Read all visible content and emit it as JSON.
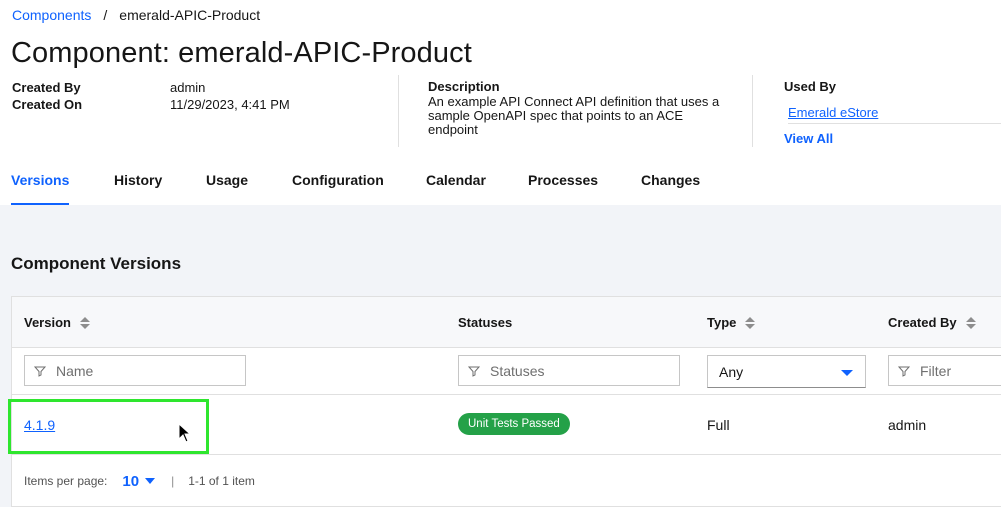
{
  "breadcrumb": {
    "root": "Components",
    "separator": "/",
    "current": "emerald-APIC-Product"
  },
  "title": "Component: emerald-APIC-Product",
  "meta": {
    "created_by_label": "Created By",
    "created_by_value": "admin",
    "created_on_label": "Created On",
    "created_on_value": "11/29/2023, 4:41 PM"
  },
  "description": {
    "label": "Description",
    "text": "An example API Connect API definition that uses a sample OpenAPI spec that points to an ACE endpoint"
  },
  "used_by": {
    "label": "Used By",
    "item": "Emerald eStore",
    "view_all": "View All"
  },
  "tabs": [
    {
      "label": "Versions",
      "active": true
    },
    {
      "label": "History",
      "active": false
    },
    {
      "label": "Usage",
      "active": false
    },
    {
      "label": "Configuration",
      "active": false
    },
    {
      "label": "Calendar",
      "active": false
    },
    {
      "label": "Processes",
      "active": false
    },
    {
      "label": "Changes",
      "active": false
    }
  ],
  "section": {
    "title": "Component Versions"
  },
  "table": {
    "columns": [
      "Version",
      "Statuses",
      "Type",
      "Created By"
    ],
    "filters": {
      "version_placeholder": "Name",
      "statuses_placeholder": "Statuses",
      "type_value": "Any",
      "created_by_placeholder": "Filter"
    },
    "rows": [
      {
        "version": "4.1.9",
        "status": "Unit Tests Passed",
        "type": "Full",
        "created_by": "admin"
      }
    ]
  },
  "pagination": {
    "items_per_page_label": "Items per page:",
    "page_size": "10",
    "separator": "|",
    "range": "1-1 of 1 item"
  },
  "colors": {
    "link": "#0f62fe",
    "status_badge": "#24a148",
    "highlight": "#2ee62e"
  }
}
